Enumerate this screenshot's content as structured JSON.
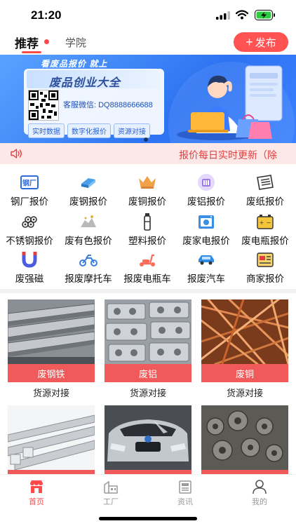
{
  "status_bar": {
    "time": "21:20"
  },
  "header": {
    "tabs": [
      {
        "label": "推荐",
        "active": true
      },
      {
        "label": "学院",
        "active": false
      }
    ],
    "publish_label": "发布",
    "accent_color": "#ff4a4a"
  },
  "banner": {
    "top_text": "看废品报价  就上",
    "title": "废品创业大全",
    "contact": "客服微信: DQ8888666688",
    "tags": [
      "实时数据",
      "数字化报价",
      "资源对接"
    ]
  },
  "notice": {
    "text": "报价每日实时更新（除"
  },
  "categories": [
    {
      "label": "钢厂报价",
      "icon": "steel-mill-icon"
    },
    {
      "label": "废钢报价",
      "icon": "steel-beam-icon"
    },
    {
      "label": "废铜报价",
      "icon": "copper-icon"
    },
    {
      "label": "废铝报价",
      "icon": "aluminum-icon"
    },
    {
      "label": "废纸报价",
      "icon": "paper-icon"
    },
    {
      "label": "不锈钢报价",
      "icon": "stainless-pipes-icon"
    },
    {
      "label": "废有色报价",
      "icon": "nonferrous-pile-icon"
    },
    {
      "label": "塑料报价",
      "icon": "plastic-bottle-icon"
    },
    {
      "label": "废家电报价",
      "icon": "appliance-icon"
    },
    {
      "label": "废电瓶报价",
      "icon": "battery-icon"
    },
    {
      "label": "废强磁",
      "icon": "magnet-icon"
    },
    {
      "label": "报废摩托车",
      "icon": "motorcycle-icon"
    },
    {
      "label": "报废电瓶车",
      "icon": "e-scooter-icon"
    },
    {
      "label": "报废汽车",
      "icon": "car-icon"
    },
    {
      "label": "商家报价",
      "icon": "merchant-quote-icon"
    }
  ],
  "products": [
    {
      "tag": "废钢铁",
      "caption": "货源对接"
    },
    {
      "tag": "废铝",
      "caption": "货源对接"
    },
    {
      "tag": "废铜",
      "caption": "货源对接"
    },
    {
      "tag": "",
      "caption": ""
    },
    {
      "tag": "",
      "caption": ""
    },
    {
      "tag": "",
      "caption": ""
    }
  ],
  "bottom_nav": [
    {
      "label": "首页",
      "icon": "home-store-icon",
      "active": true
    },
    {
      "label": "工厂",
      "icon": "factory-icon",
      "active": false
    },
    {
      "label": "资讯",
      "icon": "news-icon",
      "active": false
    },
    {
      "label": "我的",
      "icon": "profile-icon",
      "active": false
    }
  ]
}
